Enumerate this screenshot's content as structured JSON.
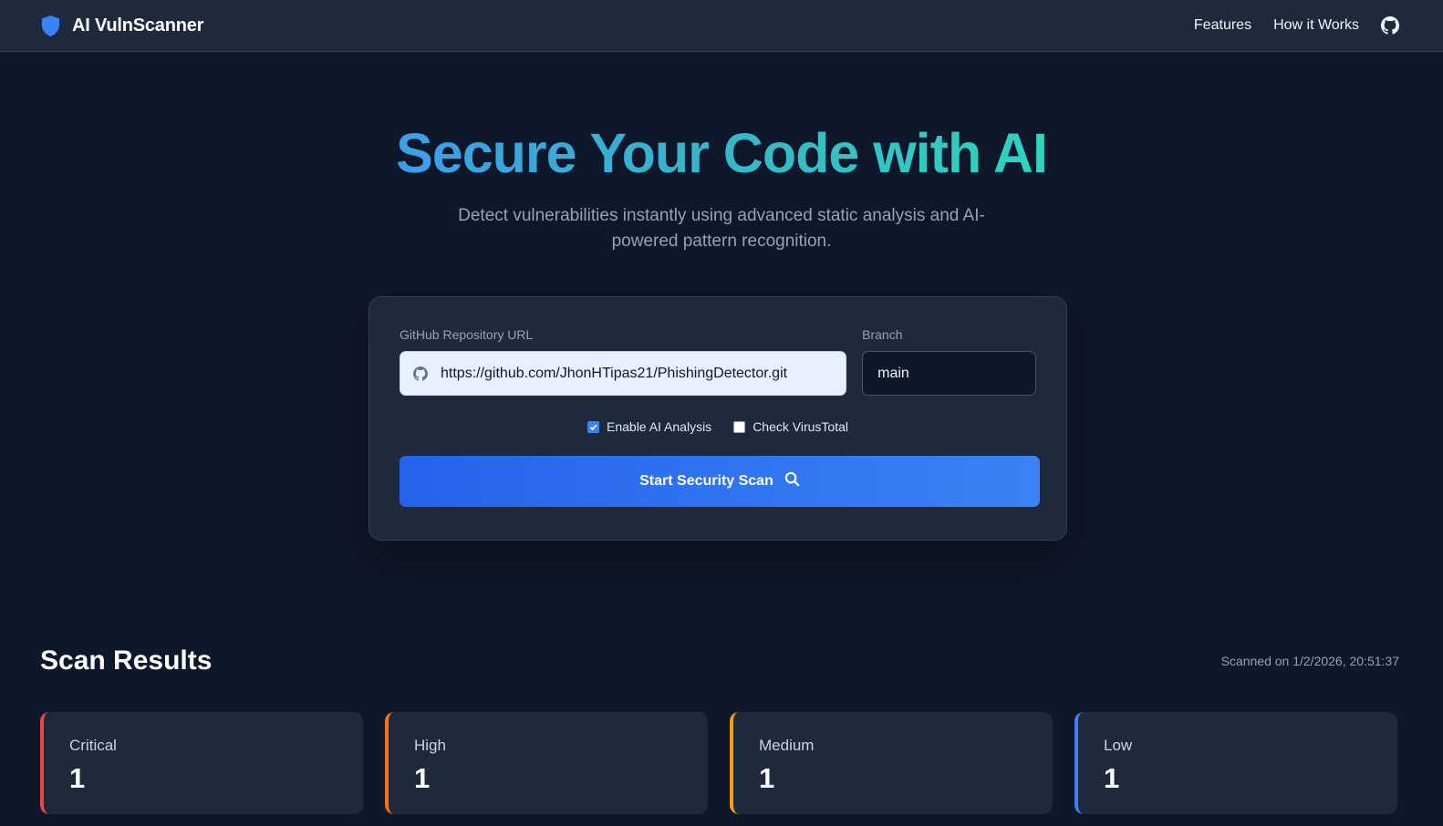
{
  "nav": {
    "brand": "AI VulnScanner",
    "links": [
      "Features",
      "How it Works"
    ],
    "icons": {
      "brand": "shield-icon",
      "github": "github-icon"
    }
  },
  "hero": {
    "title": "Secure Your Code with AI",
    "subtitle": "Detect vulnerabilities instantly using advanced static analysis and AI-powered pattern recognition."
  },
  "scan_form": {
    "repo_label": "GitHub Repository URL",
    "repo_value": "https://github.com/JhonHTipas21/PhishingDetector.git",
    "branch_label": "Branch",
    "branch_value": "main",
    "options": [
      {
        "label": "Enable AI Analysis",
        "checked": true
      },
      {
        "label": "Check VirusTotal",
        "checked": false
      }
    ],
    "button_label": "Start Security Scan",
    "button_icon": "search-icon"
  },
  "results": {
    "title": "Scan Results",
    "scanned_on": "Scanned on 1/2/2026, 20:51:37",
    "stats": [
      {
        "label": "Critical",
        "value": "1",
        "color": "#ef4444"
      },
      {
        "label": "High",
        "value": "1",
        "color": "#f97316"
      },
      {
        "label": "Medium",
        "value": "1",
        "color": "#f59e0b"
      },
      {
        "label": "Low",
        "value": "1",
        "color": "#3b82f6"
      }
    ]
  },
  "colors": {
    "background": "#0f172a",
    "surface": "#1e293b",
    "accent": "#3b82f6"
  }
}
